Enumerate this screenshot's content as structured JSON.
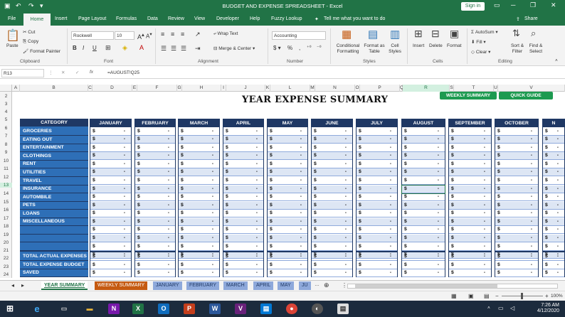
{
  "window": {
    "title": "BUDGET AND EXPENSE SPREADSHEET  -  Excel",
    "sign_in": "Sign in",
    "share": "Share"
  },
  "ribbon_tabs": [
    "File",
    "Home",
    "Insert",
    "Page Layout",
    "Formulas",
    "Data",
    "Review",
    "View",
    "Developer",
    "Help",
    "Fuzzy Lookup"
  ],
  "tell_me": "Tell me what you want to do",
  "ribbon": {
    "clipboard": {
      "paste": "Paste",
      "cut": "Cut",
      "copy": "Copy",
      "format_painter": "Format Painter",
      "group": "Clipboard"
    },
    "font": {
      "name": "Rockwell",
      "size": "10",
      "group": "Font"
    },
    "alignment": {
      "wrap": "Wrap Text",
      "merge": "Merge & Center",
      "group": "Alignment"
    },
    "number": {
      "format": "Accounting",
      "group": "Number"
    },
    "styles": {
      "cond": "Conditional Formatting",
      "table": "Format as Table",
      "cell": "Cell Styles",
      "group": "Styles"
    },
    "cells": {
      "insert": "Insert",
      "delete": "Delete",
      "format": "Format",
      "group": "Cells"
    },
    "editing": {
      "autosum": "AutoSum",
      "fill": "Fill",
      "clear": "Clear",
      "sort": "Sort & Filter",
      "find": "Find & Select",
      "group": "Editing"
    }
  },
  "formula_bar": {
    "name_box": "R13",
    "formula": "=AUGUST!Q25"
  },
  "column_headers": [
    "A",
    "B",
    "C",
    "D",
    "E",
    "F",
    "G",
    "H",
    "I",
    "J",
    "K",
    "L",
    "M",
    "N",
    "O",
    "P",
    "Q",
    "R",
    "S",
    "T",
    "U",
    "V"
  ],
  "row_numbers": [
    "2",
    "3",
    "4",
    "5",
    "6",
    "7",
    "8",
    "9",
    "10",
    "11",
    "12",
    "13",
    "14",
    "15",
    "16",
    "17",
    "18",
    "19",
    "20",
    "21",
    "22",
    "23",
    "24"
  ],
  "sheet": {
    "title": "YEAR EXPENSE SUMMARY",
    "buttons": {
      "weekly": "WEEKLY SUMMARY",
      "quick": "QUICK GUIDE"
    },
    "category_header": "CATEGORY",
    "categories": [
      "GROCERIES",
      "EATING OUT",
      "ENTERTAINMENT",
      "CLOTHINGS",
      "RENT",
      "UTILITIES",
      "TRAVEL",
      "INSURANCE",
      "AUTOMBILE",
      "PETS",
      "LOANS",
      "MISCELLANEOUS"
    ],
    "totals": [
      "TOTAL ACTUAL EXPENSES",
      "TOTAL EXPENSE BUDGET",
      "SAVED"
    ],
    "months": [
      "JANUARY",
      "FEBRUARY",
      "MARCH",
      "APRIL",
      "MAY",
      "JUNE",
      "JULY",
      "AUGUST",
      "SEPTEMBER",
      "OCTOBER",
      "N"
    ],
    "currency": "$",
    "empty_value": "-"
  },
  "sheet_tabs": [
    "YEAR SUMMARY",
    "WEEKLY SUMMARY",
    "JANUARY",
    "FEBRUARY",
    "MARCH",
    "APRIL",
    "MAY",
    "JU"
  ],
  "status": {
    "zoom": "100%"
  },
  "taskbar": {
    "time": "7:26 AM",
    "date": "4/12/2020"
  }
}
